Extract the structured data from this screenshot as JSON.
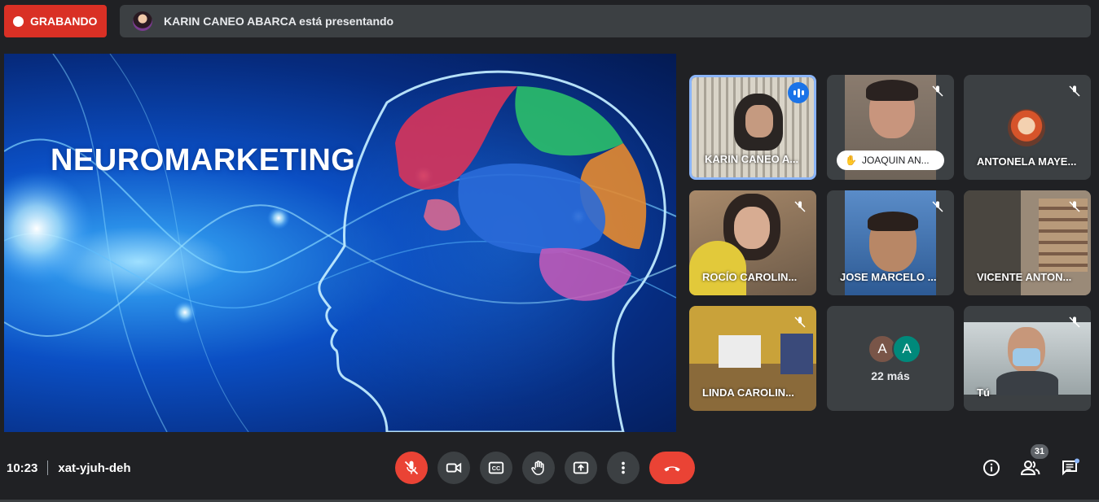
{
  "top": {
    "recording_label": "GRABANDO",
    "presenting_text": "KARIN CANEO ABARCA está presentando"
  },
  "slide": {
    "title": "NEUROMARKETING"
  },
  "participants": [
    {
      "name": "KARIN CANEO A...",
      "state": "speaking"
    },
    {
      "name": "JOAQUIN AN...",
      "state": "hand-raised-muted"
    },
    {
      "name": "ANTONELA MAYE...",
      "state": "muted-avatar"
    },
    {
      "name": "ROCÍO CAROLIN...",
      "state": "muted"
    },
    {
      "name": "JOSE MARCELO ...",
      "state": "muted"
    },
    {
      "name": "VICENTE ANTON...",
      "state": "muted"
    },
    {
      "name": "LINDA CAROLIN...",
      "state": "muted"
    },
    {
      "name": "Tú",
      "state": "muted"
    }
  ],
  "more_tile": {
    "avatars": [
      "A",
      "A"
    ],
    "label": "22 más"
  },
  "meeting": {
    "time": "10:23",
    "code": "xat-yjuh-deh"
  },
  "people_count": "31",
  "colors": {
    "background": "#202124",
    "tile": "#3c4043",
    "danger": "#ea4335",
    "active": "#8ab4f8",
    "accent": "#1a73e8"
  },
  "icons": [
    "mic-off-icon",
    "camera-icon",
    "captions-icon",
    "raise-hand-icon",
    "present-icon",
    "more-options-icon",
    "hang-up-icon",
    "info-icon",
    "people-icon",
    "chat-icon"
  ]
}
